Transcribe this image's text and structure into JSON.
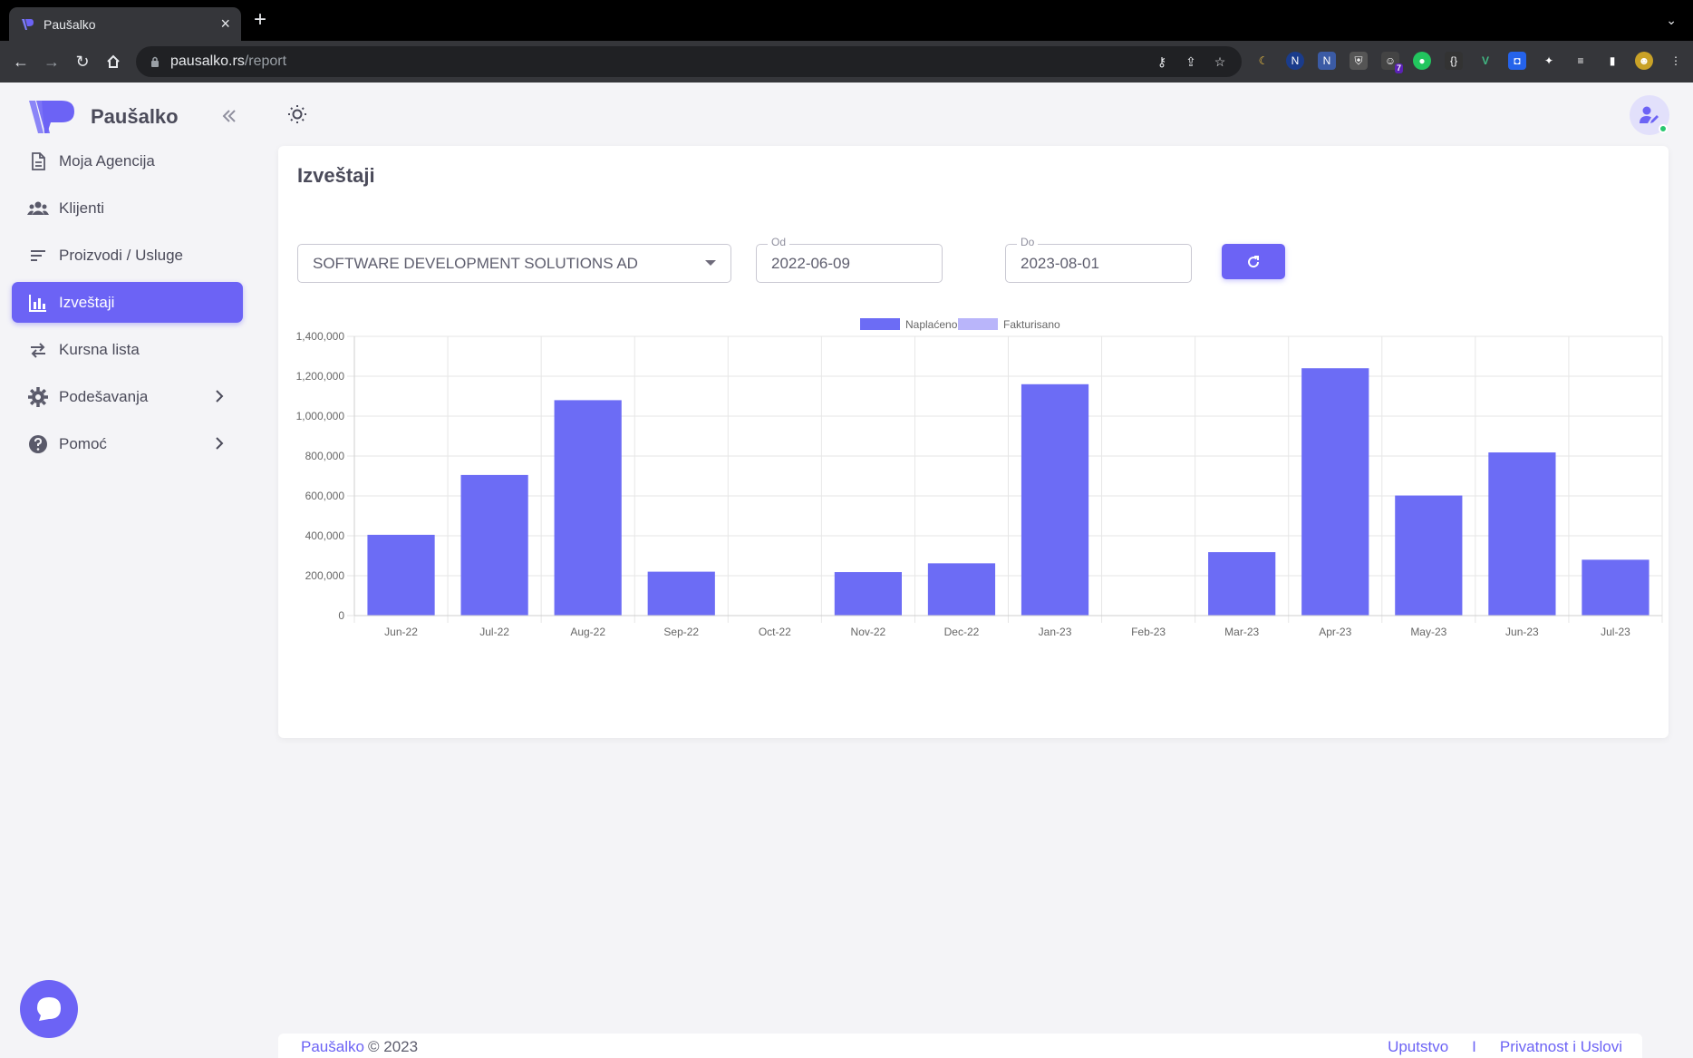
{
  "browser": {
    "tab_title": "Paušalko",
    "url_domain": "pausalko.rs",
    "url_path": "/report",
    "extension_badge": "7"
  },
  "sidebar": {
    "brand": "Paušalko",
    "items": [
      {
        "label": "Moja Agencija",
        "icon": "document-icon"
      },
      {
        "label": "Klijenti",
        "icon": "users-icon"
      },
      {
        "label": "Proizvodi / Usluge",
        "icon": "list-icon"
      },
      {
        "label": "Izveštaji",
        "icon": "bar-chart-icon",
        "active": true
      },
      {
        "label": "Kursna lista",
        "icon": "exchange-icon"
      },
      {
        "label": "Podešavanja",
        "icon": "gear-icon",
        "has_submenu": true
      },
      {
        "label": "Pomoć",
        "icon": "help-icon",
        "has_submenu": true
      }
    ]
  },
  "page": {
    "title": "Izveštaji",
    "client_select": "SOFTWARE DEVELOPMENT SOLUTIONS AD",
    "from_label": "Od",
    "from_value": "2022-06-09",
    "to_label": "Do",
    "to_value": "2023-08-01"
  },
  "footer": {
    "brand": "Paušalko",
    "copyright": "© 2023",
    "link_guide": "Uputstvo",
    "separator": "I",
    "link_privacy": "Privatnost i Uslovi"
  },
  "colors": {
    "accent": "#6c63f5",
    "accent_light": "#b9b5fa"
  },
  "chart_data": {
    "type": "bar",
    "categories": [
      "Jun-22",
      "Jul-22",
      "Aug-22",
      "Sep-22",
      "Oct-22",
      "Nov-22",
      "Dec-22",
      "Jan-23",
      "Feb-23",
      "Mar-23",
      "Apr-23",
      "May-23",
      "Jun-23",
      "Jul-23"
    ],
    "series": [
      {
        "name": "Naplaćeno",
        "color": "#6c6cf5",
        "values": [
          405000,
          705000,
          1080000,
          220000,
          0,
          218000,
          262000,
          1160000,
          0,
          318000,
          1240000,
          602000,
          818000,
          280000
        ]
      },
      {
        "name": "Fakturisano",
        "color": "#b9b5fa",
        "values": []
      }
    ],
    "ylim": [
      0,
      1400000
    ],
    "yticks": [
      "0",
      "200,000",
      "400,000",
      "600,000",
      "800,000",
      "1,000,000",
      "1,200,000",
      "1,400,000"
    ],
    "grid": true,
    "legend": "top-center"
  }
}
